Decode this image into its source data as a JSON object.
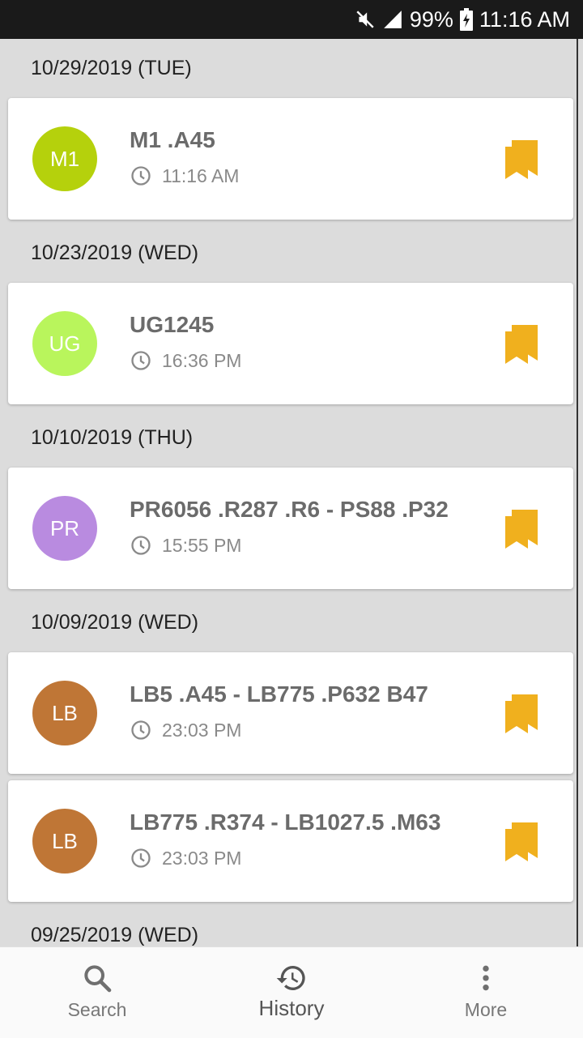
{
  "status_bar": {
    "battery": "99%",
    "time": "11:16 AM",
    "icons": [
      "mute-icon",
      "signal-icon",
      "battery-charging-icon"
    ]
  },
  "groups": [
    {
      "date": "10/29/2019 (TUE)",
      "items": [
        {
          "initials": "M1",
          "color": "#b5d10c",
          "call_number": "M1 .A45",
          "time": "11:16 AM"
        }
      ]
    },
    {
      "date": "10/23/2019 (WED)",
      "items": [
        {
          "initials": "UG",
          "color": "#b9f55c",
          "call_number": "UG1245",
          "time": "16:36 PM"
        }
      ]
    },
    {
      "date": "10/10/2019 (THU)",
      "items": [
        {
          "initials": "PR",
          "color": "#b98be0",
          "call_number": "PR6056 .R287 .R6 - PS88 .P32",
          "time": "15:55 PM"
        }
      ]
    },
    {
      "date": "10/09/2019 (WED)",
      "items": [
        {
          "initials": "LB",
          "color": "#bf7636",
          "call_number": "LB5 .A45 - LB775 .P632 B47",
          "time": "23:03 PM"
        },
        {
          "initials": "LB",
          "color": "#bf7636",
          "call_number": "LB775 .R374 - LB1027.5 .M63",
          "time": "23:03 PM"
        }
      ]
    },
    {
      "date": "09/25/2019 (WED)",
      "items": []
    }
  ],
  "accent_color": "#f0b01e",
  "bottom_nav": [
    {
      "label": "Search",
      "icon": "search-icon"
    },
    {
      "label": "History",
      "icon": "history-icon",
      "active": true
    },
    {
      "label": "More",
      "icon": "more-vert-icon"
    }
  ]
}
